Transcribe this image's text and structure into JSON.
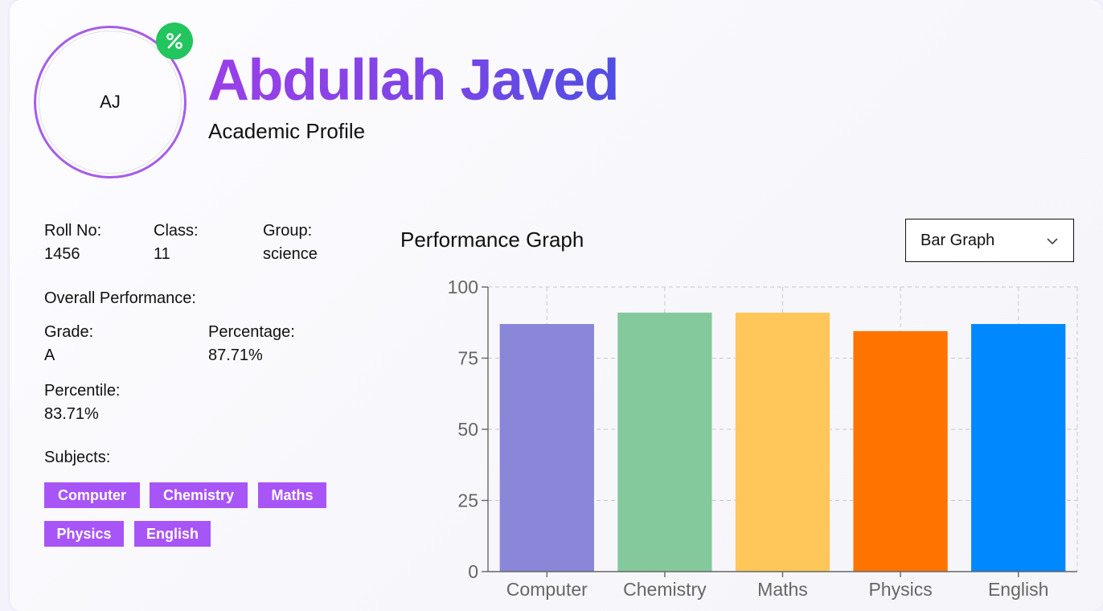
{
  "profile": {
    "initials": "AJ",
    "badge_icon": "percent-icon",
    "name": "Abdullah Javed",
    "subtitle": "Academic Profile"
  },
  "info": {
    "roll_label": "Roll No:",
    "roll_value": "1456",
    "class_label": "Class:",
    "class_value": "11",
    "group_label": "Group:",
    "group_value": "science"
  },
  "performance": {
    "heading": "Overall Performance:",
    "grade_label": "Grade:",
    "grade_value": "A",
    "percentage_label": "Percentage:",
    "percentage_value": "87.71%",
    "percentile_label": "Percentile:",
    "percentile_value": "83.71%"
  },
  "subjects": {
    "label": "Subjects:",
    "items": [
      "Computer",
      "Chemistry",
      "Maths",
      "Physics",
      "English"
    ]
  },
  "graph": {
    "title": "Performance Graph",
    "view_selected": "Bar Graph"
  },
  "colors": {
    "accent": "#a855f7",
    "badge": "#22c55e",
    "bars": [
      "#8a86d8",
      "#84c99c",
      "#ffc75a",
      "#ff7300",
      "#0088fe"
    ]
  },
  "chart_data": {
    "type": "bar",
    "categories": [
      "Computer",
      "Chemistry",
      "Maths",
      "Physics",
      "English"
    ],
    "values": [
      87,
      91,
      91,
      84.5,
      87
    ],
    "ylim": [
      0,
      100
    ],
    "yticks": [
      0,
      25,
      50,
      75,
      100
    ],
    "grid": true,
    "title": "",
    "xlabel": "",
    "ylabel": ""
  }
}
